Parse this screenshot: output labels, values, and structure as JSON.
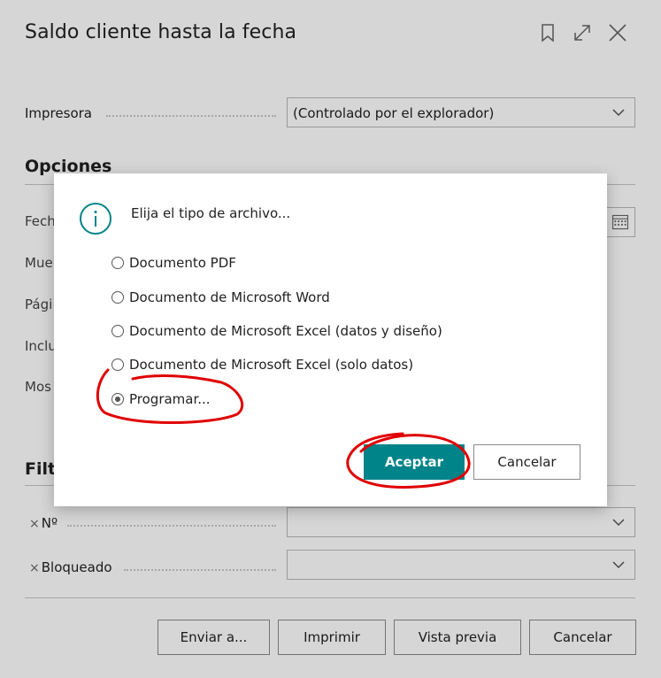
{
  "page": {
    "title": "Saldo cliente hasta la fecha",
    "header_icons": [
      "bookmark-icon",
      "expand-icon",
      "close-icon"
    ],
    "printer": {
      "label": "Impresora",
      "value": "(Controlado por el explorador)"
    },
    "options": {
      "title": "Opciones",
      "labels": [
        "Fech",
        "Mue",
        "Pági",
        "Inclu",
        "Mos"
      ]
    },
    "filters": {
      "title": "Filt",
      "rows": [
        {
          "label": "Nº",
          "value": ""
        },
        {
          "label": "Bloqueado",
          "value": ""
        }
      ]
    },
    "buttons": {
      "send": "Enviar a...",
      "print": "Imprimir",
      "preview": "Vista previa",
      "cancel": "Cancelar"
    }
  },
  "dialog": {
    "icon": "info-icon",
    "message": "Elija el tipo de archivo...",
    "options": [
      {
        "label": "Documento PDF",
        "selected": false
      },
      {
        "label": "Documento de Microsoft Word",
        "selected": false
      },
      {
        "label": "Documento de Microsoft Excel (datos y diseño)",
        "selected": false
      },
      {
        "label": "Documento de Microsoft Excel (solo datos)",
        "selected": false
      },
      {
        "label": "Programar...",
        "selected": true
      }
    ],
    "ok_label": "Aceptar",
    "cancel_label": "Cancelar"
  },
  "colors": {
    "accent": "#008489",
    "annotation": "#e00000"
  }
}
